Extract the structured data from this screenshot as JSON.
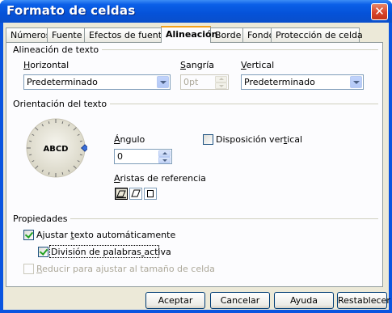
{
  "window": {
    "title": "Formato de celdas",
    "close_glyph": "✕"
  },
  "tabs": [
    {
      "label": "Números"
    },
    {
      "label": "Fuente"
    },
    {
      "label": "Efectos de fuente"
    },
    {
      "label": "Alineación",
      "active": true
    },
    {
      "label": "Borde"
    },
    {
      "label": "Fondo"
    },
    {
      "label": "Protección de celda"
    }
  ],
  "alignment": {
    "section": "Alineación de texto",
    "horizontal": {
      "label": "Horizontal",
      "value": "Predeterminado"
    },
    "indent": {
      "label": "Sangría",
      "value": "0pt",
      "disabled": true
    },
    "vertical": {
      "label": "Vertical",
      "value": "Predeterminado"
    }
  },
  "orientation": {
    "section": "Orientación del texto",
    "dial_text": "ABCD",
    "angle": {
      "label": "Ángulo",
      "value": "0"
    },
    "vertical_layout": {
      "label": "Disposición vertical",
      "checked": false
    },
    "reference_edges": {
      "label": "Aristas de referencia"
    }
  },
  "properties": {
    "section": "Propiedades",
    "wrap": {
      "label": "Ajustar texto automáticamente",
      "checked": true
    },
    "hyphenation": {
      "label": "División de palabras activa",
      "checked": true
    },
    "shrink": {
      "label": "Reducir para ajustar al tamaño de celda",
      "checked": false,
      "disabled": true
    }
  },
  "buttons": {
    "ok": "Aceptar",
    "cancel": "Cancelar",
    "help": "Ayuda",
    "reset": "Restablecer"
  },
  "colors": {
    "titlebar": "#0a55e0",
    "dialog_bg": "#ece9d8",
    "accent_tab": "#f5a21c",
    "check": "#21a121"
  }
}
